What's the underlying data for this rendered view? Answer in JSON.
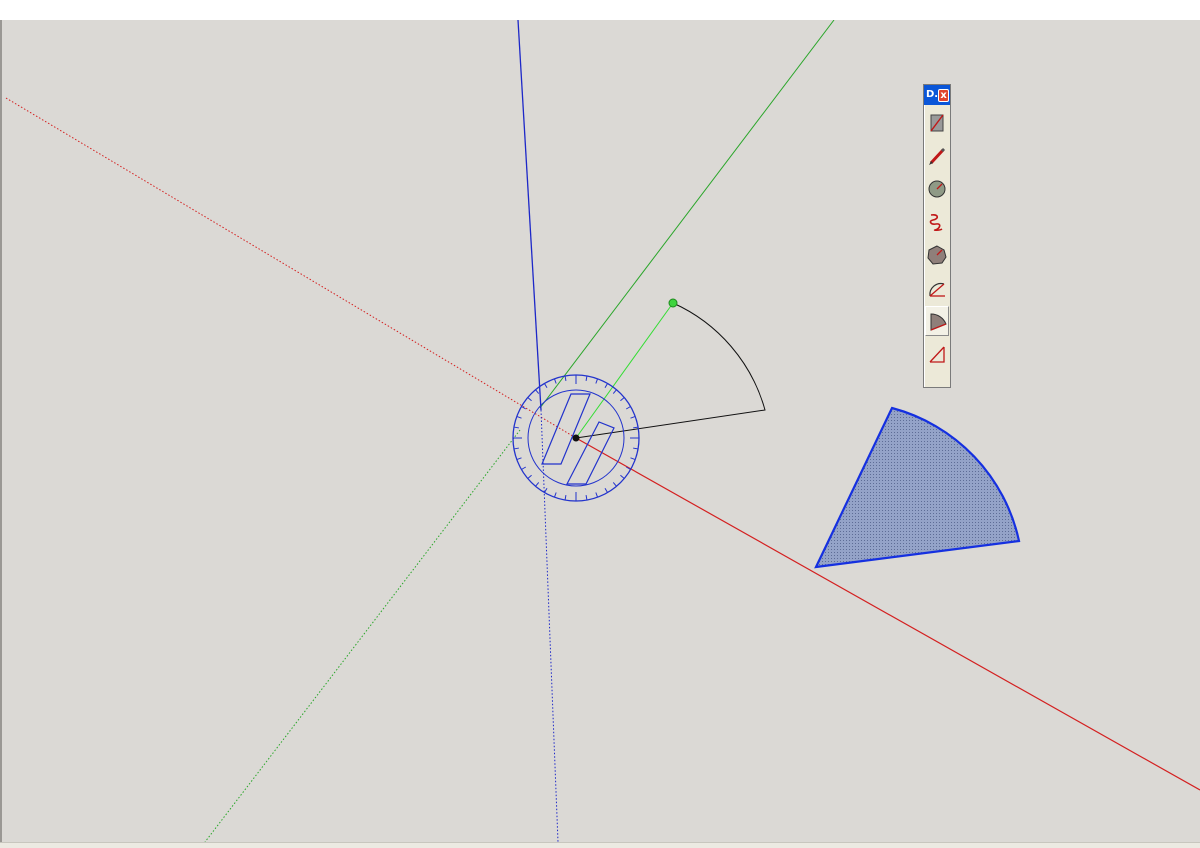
{
  "toolbar": {
    "title": "D.",
    "close_label": "x",
    "tools": [
      {
        "name": "rectangle-tool",
        "icon": "rectangle-icon",
        "active": false
      },
      {
        "name": "pencil-tool",
        "icon": "pencil-icon",
        "active": false
      },
      {
        "name": "circle-tool",
        "icon": "circle-icon",
        "active": false
      },
      {
        "name": "freehand-tool",
        "icon": "freehand-icon",
        "active": false
      },
      {
        "name": "polygon-tool",
        "icon": "polygon-icon",
        "active": false
      },
      {
        "name": "arc-tool",
        "icon": "arc-icon",
        "active": false
      },
      {
        "name": "pie-tool",
        "icon": "pie-icon",
        "active": true
      },
      {
        "name": "two-point-arc-tool",
        "icon": "two-point-arc-icon",
        "active": false
      }
    ]
  },
  "colors": {
    "viewport_bg": "#dbd9d5",
    "red_axis": "#d42020",
    "green_axis": "#2aa62a",
    "blue_axis": "#1d28c8",
    "protractor": "#2233cc",
    "pie_fill": "#8a9bc2",
    "pie_edge": "#1530e0",
    "toolbar_title_bg": "#0a56d8",
    "toolbar_close_bg": "#e0452e"
  }
}
